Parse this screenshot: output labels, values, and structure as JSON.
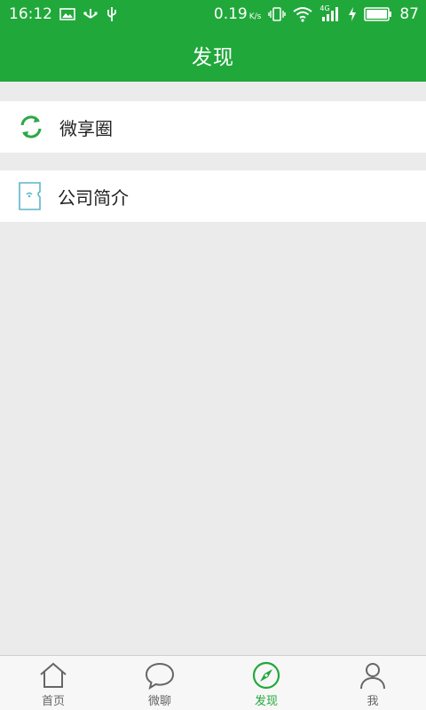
{
  "status_bar": {
    "time": "16:12",
    "speed": "0.19",
    "speed_unit": "K/s",
    "network": "4G",
    "battery": "87",
    "icons": [
      "image-icon",
      "usb-icon",
      "vibrate-icon",
      "wifi-icon",
      "signal-icon",
      "charging-icon",
      "battery-icon"
    ]
  },
  "header": {
    "title": "发现"
  },
  "menu": {
    "items": [
      {
        "label": "微享圈",
        "icon": "refresh-circle-icon"
      },
      {
        "label": "公司简介",
        "icon": "document-icon"
      }
    ]
  },
  "tabbar": {
    "tabs": [
      {
        "label": "首页",
        "icon": "home-icon"
      },
      {
        "label": "微聊",
        "icon": "chat-bubble-icon"
      },
      {
        "label": "发现",
        "icon": "compass-icon",
        "active": true
      },
      {
        "label": "我",
        "icon": "person-icon"
      }
    ]
  },
  "colors": {
    "brand": "#21a83b",
    "background": "#ebebeb"
  }
}
